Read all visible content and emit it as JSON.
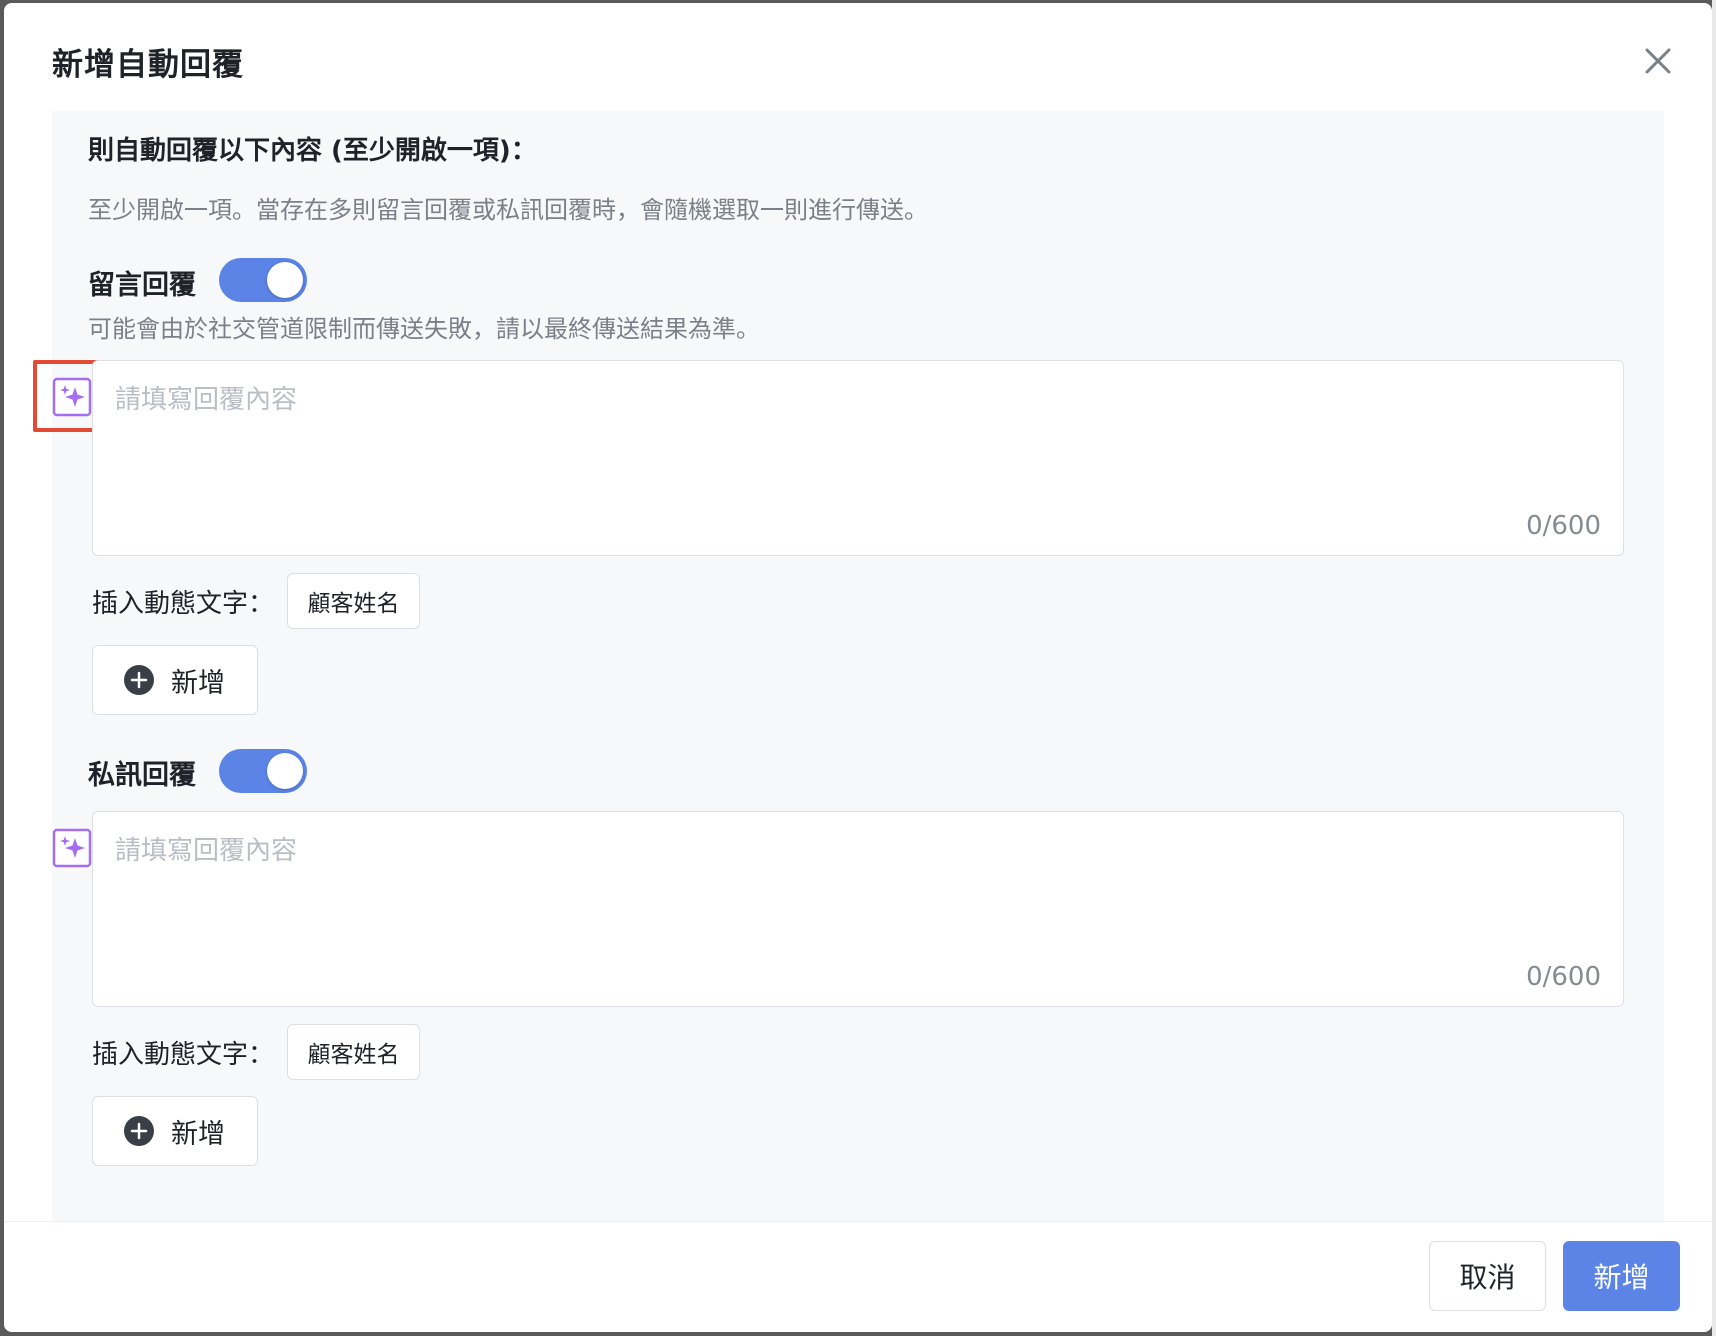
{
  "dialog": {
    "title": "新增自動回覆",
    "close_icon": "close-icon"
  },
  "content": {
    "heading": "則自動回覆以下內容 (至少開啟一項)：",
    "description": "至少開啟一項。當存在多則留言回覆或私訊回覆時，會隨機選取一則進行傳送。"
  },
  "comment_reply": {
    "label": "留言回覆",
    "enabled": true,
    "note": "可能會由於社交管道限制而傳送失敗，請以最終傳送結果為準。",
    "placeholder": "請填寫回覆內容",
    "counter": "0/600",
    "ai_icon": "sparkle-ai-icon",
    "highlighted": true,
    "dynamic_label": "插入動態文字：",
    "dynamic_tag": "顧客姓名",
    "add_label": "新增"
  },
  "dm_reply": {
    "label": "私訊回覆",
    "enabled": true,
    "placeholder": "請填寫回覆內容",
    "counter": "0/600",
    "ai_icon": "sparkle-ai-icon",
    "dynamic_label": "插入動態文字：",
    "dynamic_tag": "顧客姓名",
    "add_label": "新增"
  },
  "footer": {
    "cancel_label": "取消",
    "submit_label": "新增"
  },
  "colors": {
    "primary": "#5b84e6",
    "ai_purple": "#a56ef0",
    "annotation_red": "#e24a33"
  }
}
